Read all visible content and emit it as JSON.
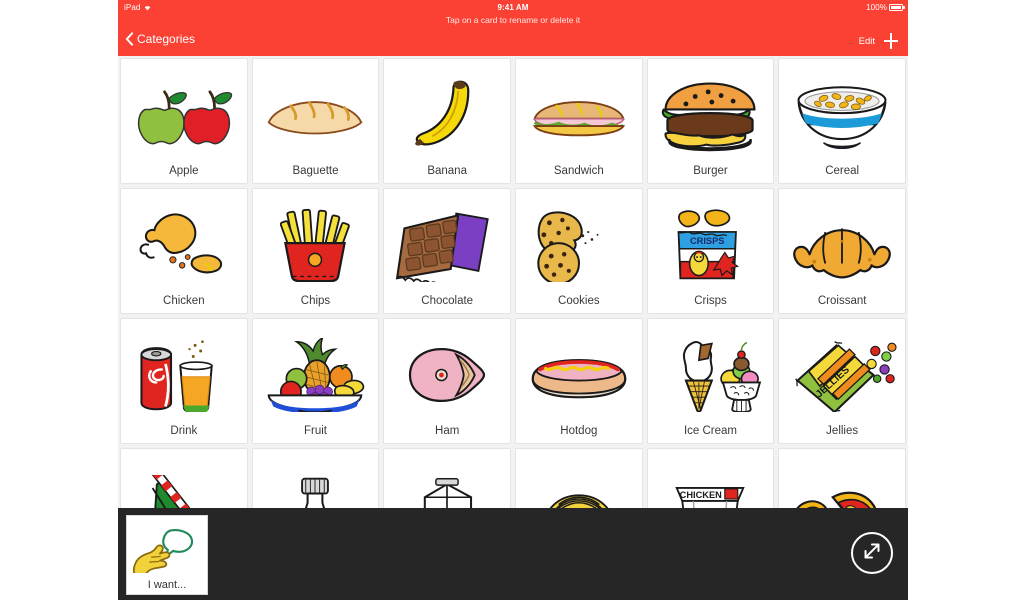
{
  "theme": {
    "nav_red": "#fb4034",
    "page_bg": "#f2f2f2",
    "bottom_bar": "#262626",
    "caption_color": "#3a3a3a"
  },
  "status_bar": {
    "device": "iPad",
    "wifi_icon": "wifi-icon",
    "time": "9:41 AM",
    "battery_percent": "100%",
    "battery_icon": "battery-full-icon"
  },
  "nav": {
    "hint": "Tap on a card to rename or delete it",
    "back_label": "Categories",
    "back_icon": "chevron-left-icon",
    "edit_label": "Edit",
    "add_icon": "plus-icon"
  },
  "grid": {
    "cards": [
      {
        "label": "Apple",
        "icon": "apple-icon"
      },
      {
        "label": "Baguette",
        "icon": "baguette-icon"
      },
      {
        "label": "Banana",
        "icon": "banana-icon"
      },
      {
        "label": "Sandwich",
        "icon": "sandwich-icon"
      },
      {
        "label": "Burger",
        "icon": "burger-icon"
      },
      {
        "label": "Cereal",
        "icon": "cereal-bowl-icon"
      },
      {
        "label": "Chicken",
        "icon": "chicken-drumstick-icon"
      },
      {
        "label": "Chips",
        "icon": "fries-icon"
      },
      {
        "label": "Chocolate",
        "icon": "chocolate-bar-icon"
      },
      {
        "label": "Cookies",
        "icon": "cookies-icon"
      },
      {
        "label": "Crisps",
        "icon": "crisps-packet-icon"
      },
      {
        "label": "Croissant",
        "icon": "croissant-icon"
      },
      {
        "label": "Drink",
        "icon": "can-and-glass-icon"
      },
      {
        "label": "Fruit",
        "icon": "fruit-bowl-icon"
      },
      {
        "label": "Ham",
        "icon": "ham-icon"
      },
      {
        "label": "Hotdog",
        "icon": "hotdog-icon"
      },
      {
        "label": "Ice Cream",
        "icon": "ice-cream-icon"
      },
      {
        "label": "Jellies",
        "icon": "jellies-packet-icon"
      },
      {
        "label": "",
        "icon": "juice-carton-icon"
      },
      {
        "label": "",
        "icon": "bottle-icon"
      },
      {
        "label": "",
        "icon": "milk-carton-icon"
      },
      {
        "label": "",
        "icon": "noodles-icon"
      },
      {
        "label": "",
        "icon": "chicken-box-icon"
      },
      {
        "label": "",
        "icon": "pizza-icon"
      }
    ]
  },
  "packaging_text": {
    "crisps": "CRISPS",
    "jellies": "JELLIES",
    "chicken_box": "CHICKEN"
  },
  "bottom_bar": {
    "sentence_card_label": "I want...",
    "sentence_card_icon": "hand-speech-icon",
    "expand_icon": "expand-diagonal-icon"
  }
}
